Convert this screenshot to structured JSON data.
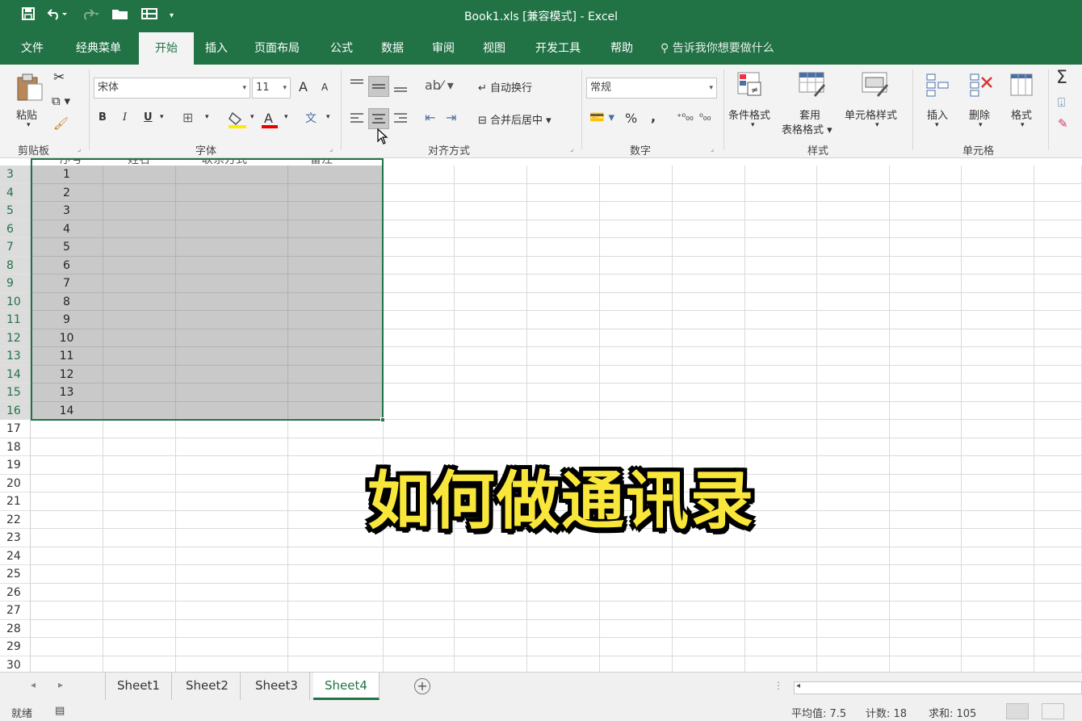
{
  "title": "Book1.xls  [兼容模式]  -  Excel",
  "tabs": [
    {
      "label": "文件"
    },
    {
      "label": "经典菜单"
    },
    {
      "label": "开始"
    },
    {
      "label": "插入"
    },
    {
      "label": "页面布局"
    },
    {
      "label": "公式"
    },
    {
      "label": "数据"
    },
    {
      "label": "审阅"
    },
    {
      "label": "视图"
    },
    {
      "label": "开发工具"
    },
    {
      "label": "帮助"
    }
  ],
  "tell_me": "告诉我你想要做什么",
  "clipboard": {
    "paste": "粘贴",
    "group": "剪贴板"
  },
  "font": {
    "name": "宋体",
    "size": "11",
    "bold": "B",
    "italic": "I",
    "underline": "U",
    "group": "字体",
    "grow": "A",
    "shrink": "A",
    "font_color": "A",
    "phonetic": "文"
  },
  "alignment": {
    "wrap": "自动换行",
    "merge": "合并后居中",
    "group": "对齐方式"
  },
  "number": {
    "format": "常规",
    "percent": "%",
    "comma": ",",
    "group": "数字"
  },
  "styles": {
    "conditional": "条件格式",
    "table": "套用",
    "table2": "表格格式",
    "cell_styles": "单元格样式",
    "group": "样式"
  },
  "cells": {
    "insert": "插入",
    "delete": "删除",
    "format": "格式",
    "group": "单元格"
  },
  "editing": {
    "sum": "Σ"
  },
  "header_fragments": [
    "序号",
    "姓名",
    "联系方式",
    "备注"
  ],
  "row_numbers": [
    "3",
    "4",
    "5",
    "6",
    "7",
    "8",
    "9",
    "10",
    "11",
    "12",
    "13",
    "14",
    "15",
    "16",
    "17",
    "18",
    "19",
    "20",
    "21",
    "22",
    "23",
    "24",
    "25",
    "26",
    "27",
    "28",
    "29",
    "30"
  ],
  "row_values": [
    "1",
    "2",
    "3",
    "4",
    "5",
    "6",
    "7",
    "8",
    "9",
    "10",
    "11",
    "12",
    "13",
    "14",
    "",
    "",
    "",
    "",
    "",
    "",
    "",
    "",
    "",
    "",
    "",
    "",
    "",
    ""
  ],
  "overlay_text": "如何做通讯录",
  "sheets": [
    "Sheet1",
    "Sheet2",
    "Sheet3",
    "Sheet4"
  ],
  "status": {
    "ready": "就绪",
    "average": "平均值: 7.5",
    "count": "计数: 18",
    "sum": "求和: 105"
  },
  "colors": {
    "accent": "#217346",
    "selection": "#c9c9c9",
    "overlay": "#f8e63a"
  }
}
